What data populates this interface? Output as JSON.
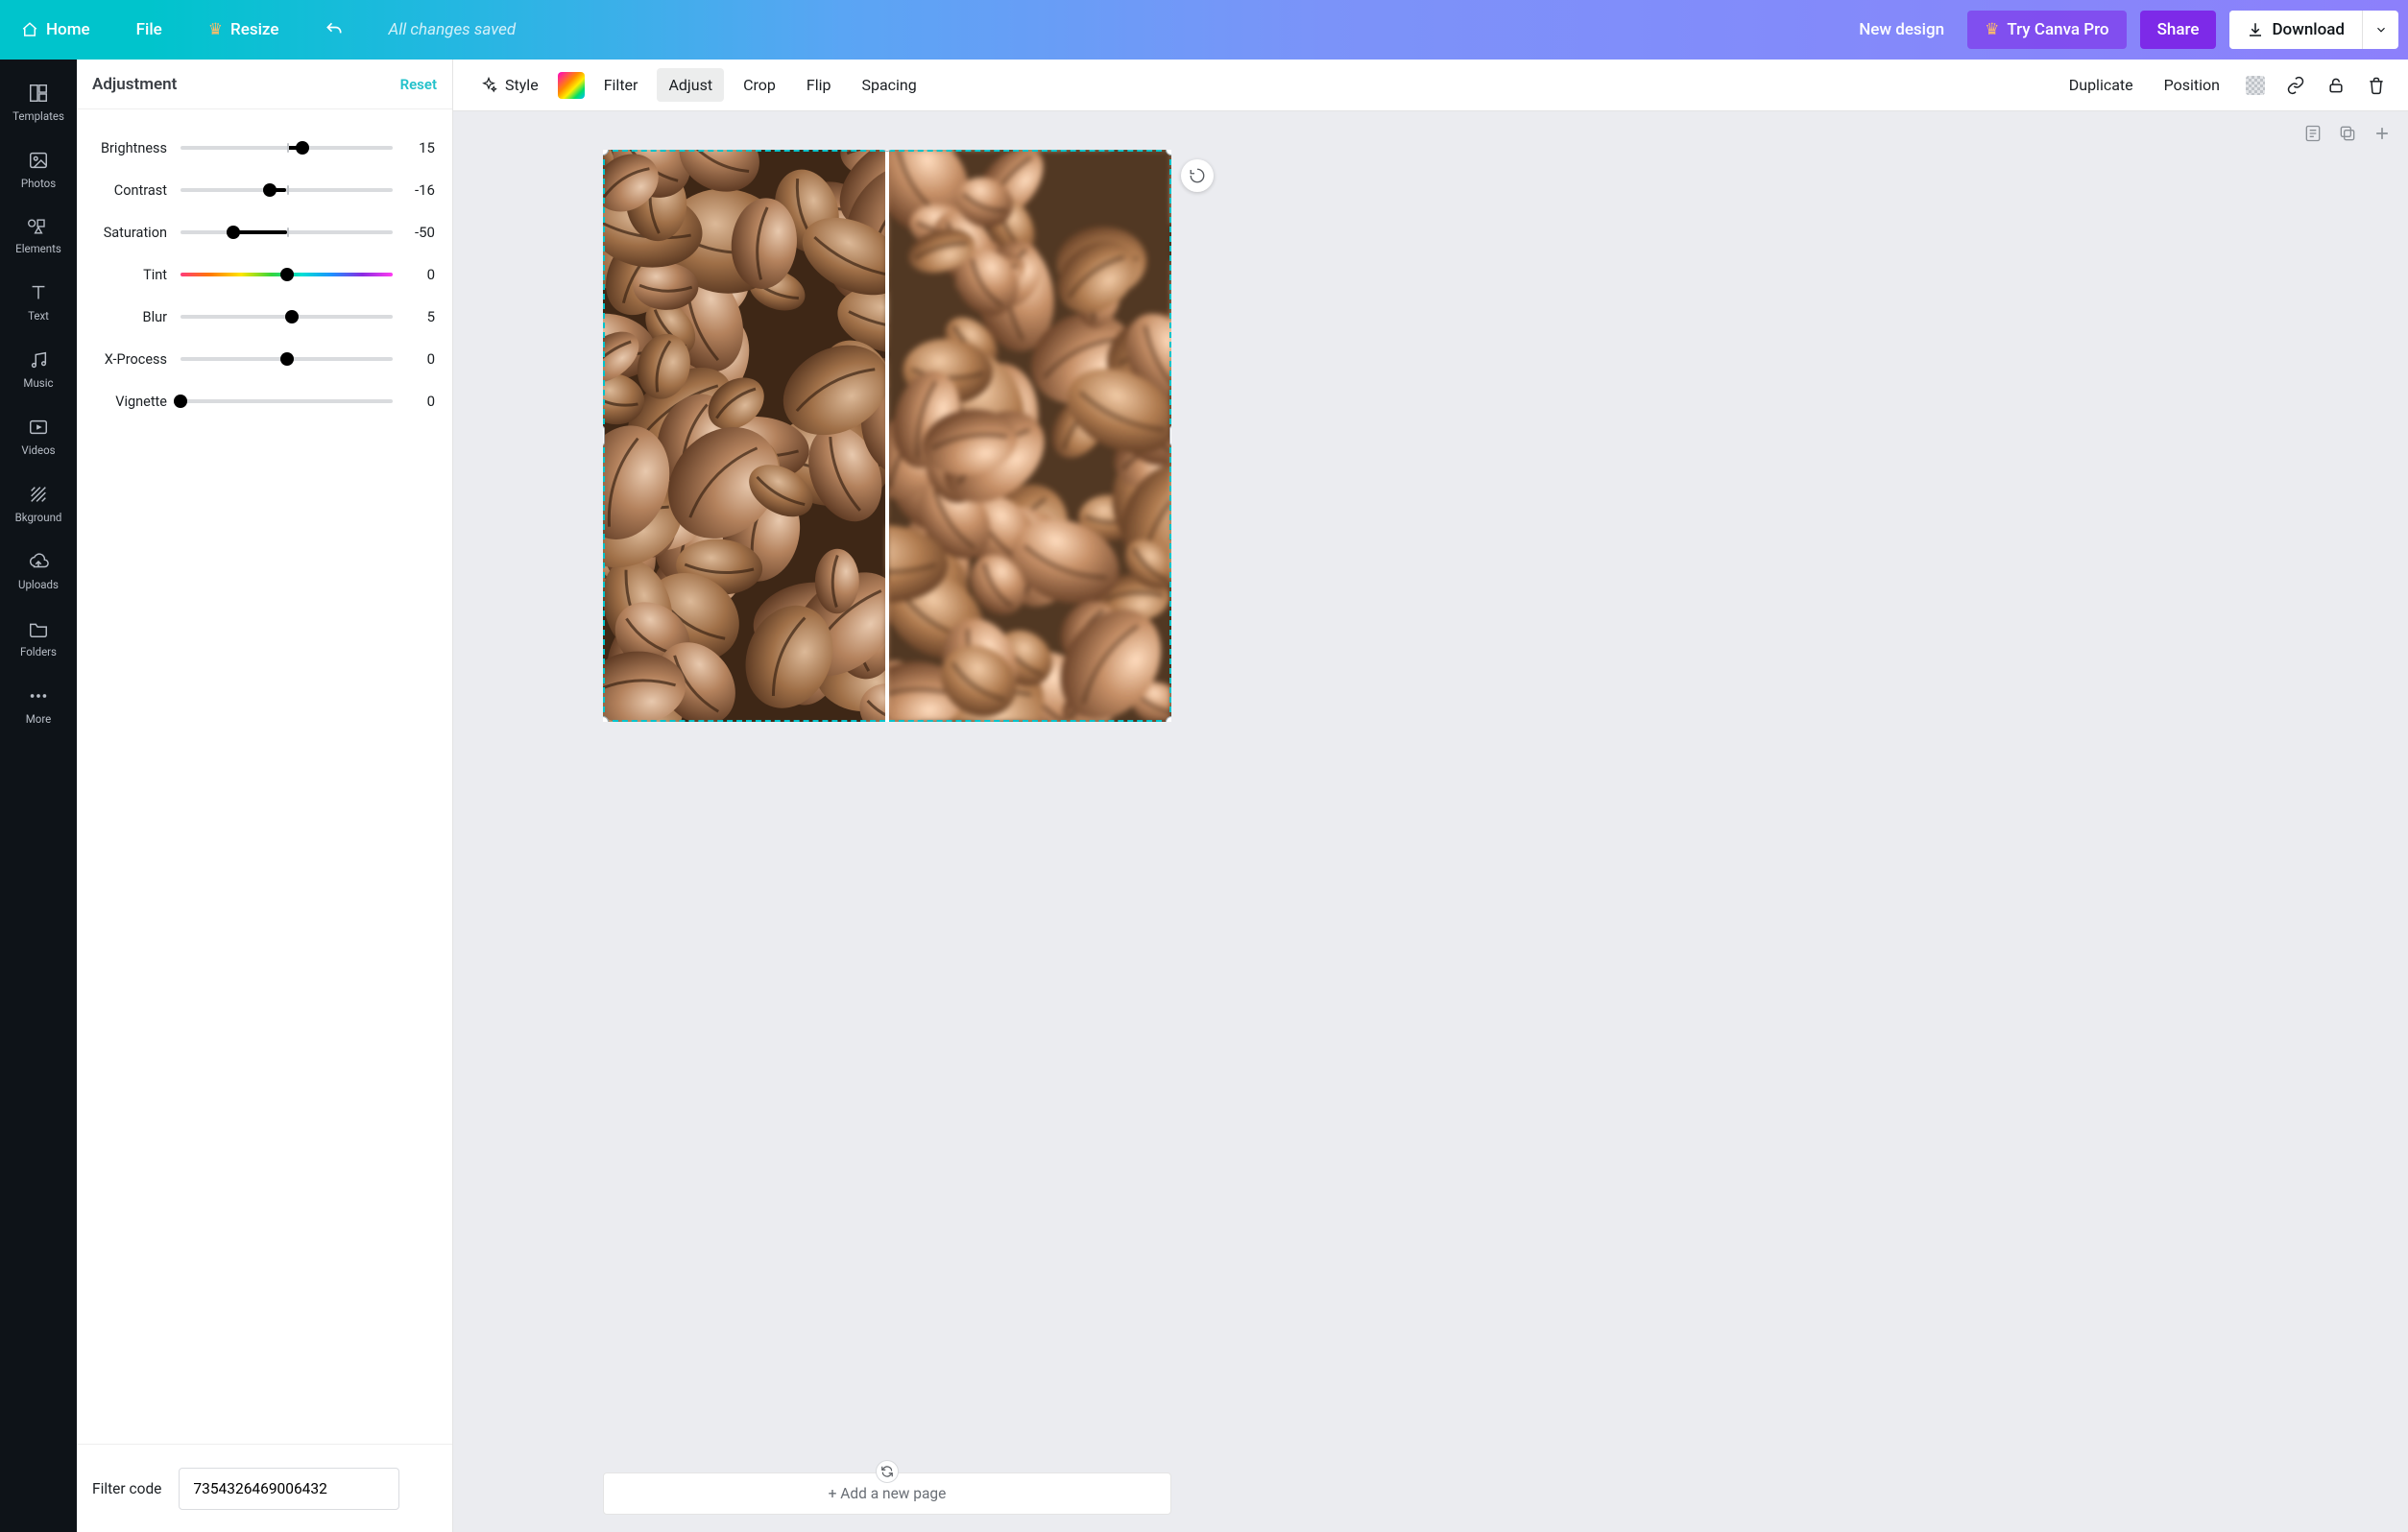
{
  "topbar": {
    "home": "Home",
    "file": "File",
    "resize": "Resize",
    "status": "All changes saved",
    "new_design": "New design",
    "try_pro": "Try Canva Pro",
    "share": "Share",
    "download": "Download"
  },
  "rail": {
    "items": [
      {
        "label": "Templates"
      },
      {
        "label": "Photos"
      },
      {
        "label": "Elements"
      },
      {
        "label": "Text"
      },
      {
        "label": "Music"
      },
      {
        "label": "Videos"
      },
      {
        "label": "Bkground"
      },
      {
        "label": "Uploads"
      },
      {
        "label": "Folders"
      },
      {
        "label": "More"
      }
    ]
  },
  "panel": {
    "title": "Adjustment",
    "reset": "Reset",
    "sliders": [
      {
        "label": "Brightness",
        "value": "15",
        "min": -100,
        "max": 100,
        "pos": 0.575,
        "centered": true
      },
      {
        "label": "Contrast",
        "value": "-16",
        "min": -100,
        "max": 100,
        "pos": 0.42,
        "centered": true
      },
      {
        "label": "Saturation",
        "value": "-50",
        "min": -100,
        "max": 100,
        "pos": 0.25,
        "centered": true
      },
      {
        "label": "Tint",
        "value": "0",
        "min": -100,
        "max": 100,
        "pos": 0.5,
        "centered": true,
        "rainbow": true
      },
      {
        "label": "Blur",
        "value": "5",
        "min": -100,
        "max": 100,
        "pos": 0.525,
        "centered": true
      },
      {
        "label": "X-Process",
        "value": "0",
        "min": -100,
        "max": 100,
        "pos": 0.5,
        "centered": true
      },
      {
        "label": "Vignette",
        "value": "0",
        "min": 0,
        "max": 100,
        "pos": 0.0,
        "centered": false
      }
    ],
    "filter_code_label": "Filter code",
    "filter_code": "7354326469006432"
  },
  "ctx": {
    "style": "Style",
    "filter": "Filter",
    "adjust": "Adjust",
    "crop": "Crop",
    "flip": "Flip",
    "spacing": "Spacing",
    "duplicate": "Duplicate",
    "position": "Position"
  },
  "stage": {
    "add_page": "+ Add a new page"
  }
}
